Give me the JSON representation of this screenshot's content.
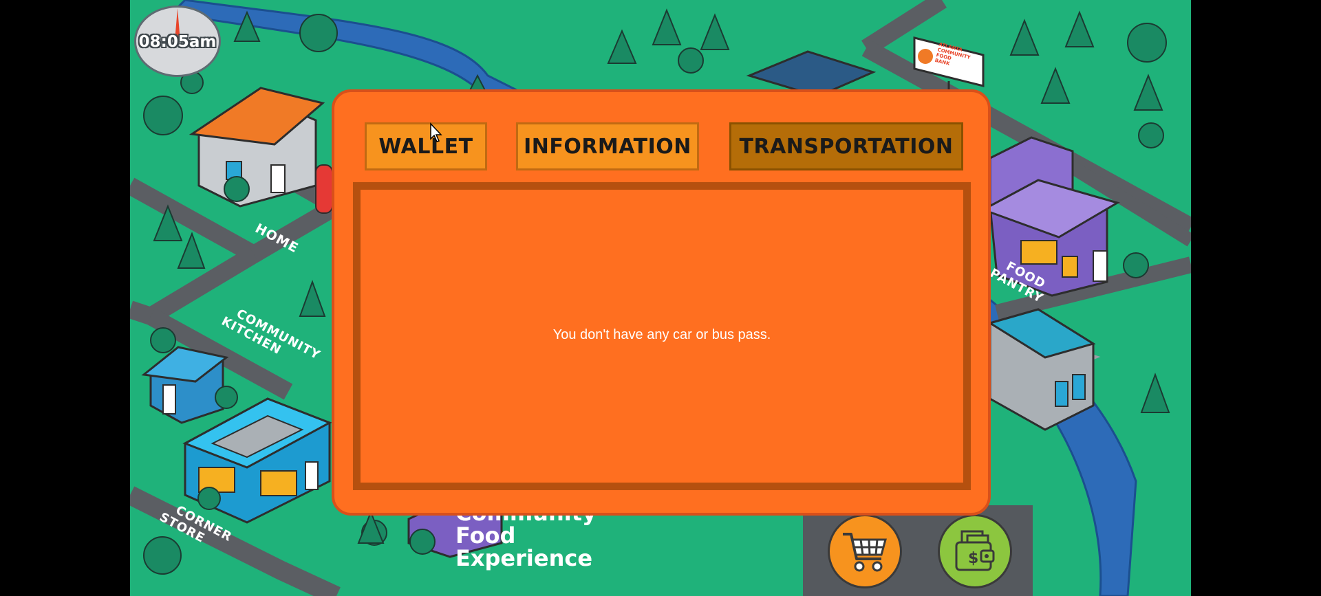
{
  "clock": {
    "time": "08:05am"
  },
  "map": {
    "labels": {
      "home": "HOME",
      "community_kitchen_line1": "COMMUNITY",
      "community_kitchen_line2": "KITCHEN",
      "corner_store_line1": "CORNER",
      "corner_store_line2": "STORE",
      "food_pantry_line1": "FOOD",
      "food_pantry_line2": "PANTRY"
    },
    "billboard": {
      "line1": "ATLANTA",
      "line2": "COMMUNITY",
      "line3": "FOOD",
      "line4": "BANK"
    }
  },
  "game_title": {
    "line1": "Community",
    "line2": "Food",
    "line3": "Experience"
  },
  "modal": {
    "tabs": [
      {
        "label": "WALLET",
        "active": false
      },
      {
        "label": "INFORMATION",
        "active": false
      },
      {
        "label": "TRANSPORTATION",
        "active": true
      }
    ],
    "message": "You don't have any car or bus pass."
  },
  "actions": {
    "cart_icon": "shopping-cart-icon",
    "wallet_icon": "wallet-money-icon"
  },
  "colors": {
    "map_green": "#1fb27a",
    "road_gray": "#5b5e63",
    "river_blue": "#2d6bb8",
    "modal_orange": "#ff6f20",
    "tab_orange": "#f7931e",
    "tab_active": "#b56d08",
    "panel_border": "#b5500f",
    "cart_button": "#f7931e",
    "wallet_button": "#8cc63f"
  }
}
